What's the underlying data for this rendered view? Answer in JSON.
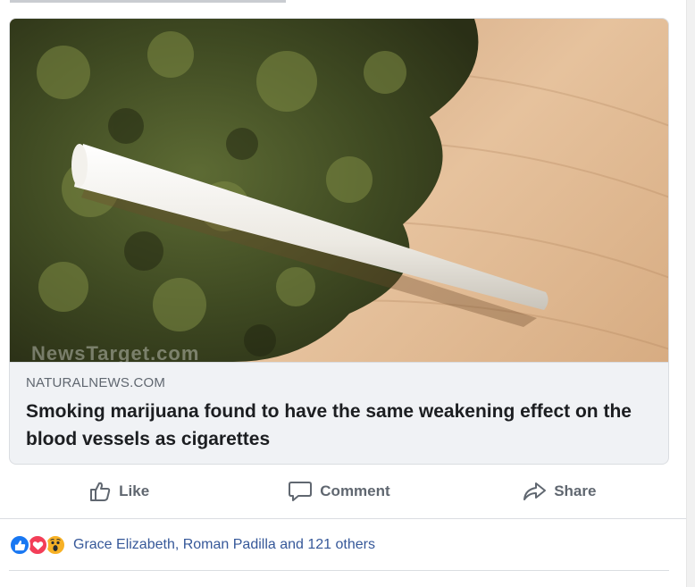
{
  "link_preview": {
    "domain": "NATURALNEWS.COM",
    "title": "Smoking marijuana found to have the same weakening effect on the blood vessels as cigarettes",
    "watermark": "NewsTarget.com"
  },
  "actions": {
    "like_label": "Like",
    "comment_label": "Comment",
    "share_label": "Share"
  },
  "reactions": {
    "types": [
      "like-icon",
      "love-icon",
      "wow-icon"
    ],
    "summary": "Grace Elizabeth, Roman Padilla and 121 others"
  },
  "colors": {
    "text_secondary": "#606770",
    "link_blue": "#365899",
    "like_blue": "#1877f2",
    "love_red": "#f33e58",
    "wow_yellow": "#f7b125"
  }
}
